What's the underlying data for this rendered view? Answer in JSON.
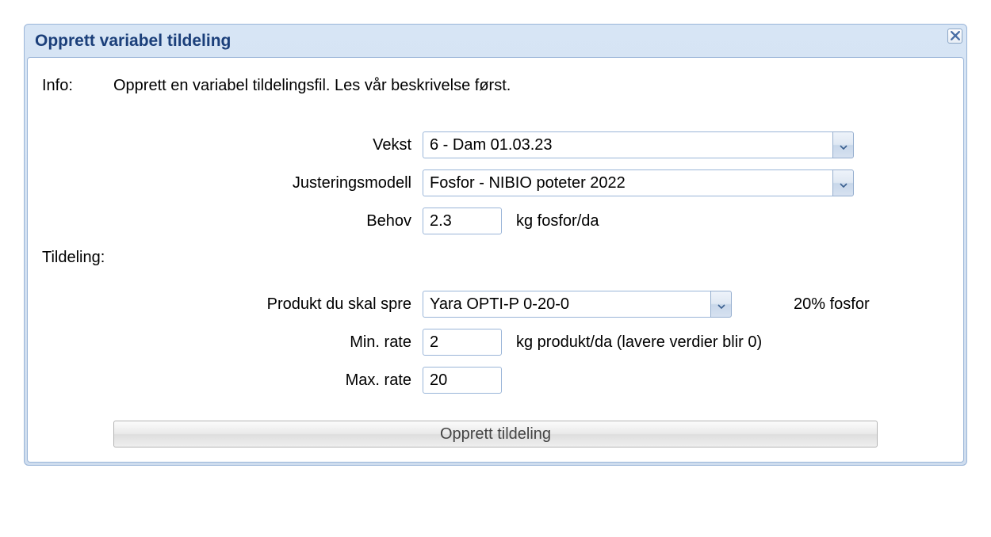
{
  "dialog": {
    "title": "Opprett variabel tildeling"
  },
  "info": {
    "label": "Info:",
    "text": "Opprett en variabel tildelingsfil. Les vår beskrivelse først."
  },
  "fields": {
    "vekst": {
      "label": "Vekst",
      "value": "6 - Dam 01.03.23"
    },
    "justeringsmodell": {
      "label": "Justeringsmodell",
      "value": "Fosfor - NIBIO poteter 2022"
    },
    "behov": {
      "label": "Behov",
      "value": "2.3",
      "unit": "kg fosfor/da"
    }
  },
  "tildeling": {
    "label": "Tildeling:",
    "produkt": {
      "label": "Produkt du skal spre",
      "value": "Yara OPTI-P 0-20-0",
      "aux": "20% fosfor"
    },
    "min_rate": {
      "label": "Min. rate",
      "value": "2",
      "unit": "kg produkt/da (lavere verdier blir 0)"
    },
    "max_rate": {
      "label": "Max. rate",
      "value": "20"
    }
  },
  "submit_label": "Opprett tildeling"
}
